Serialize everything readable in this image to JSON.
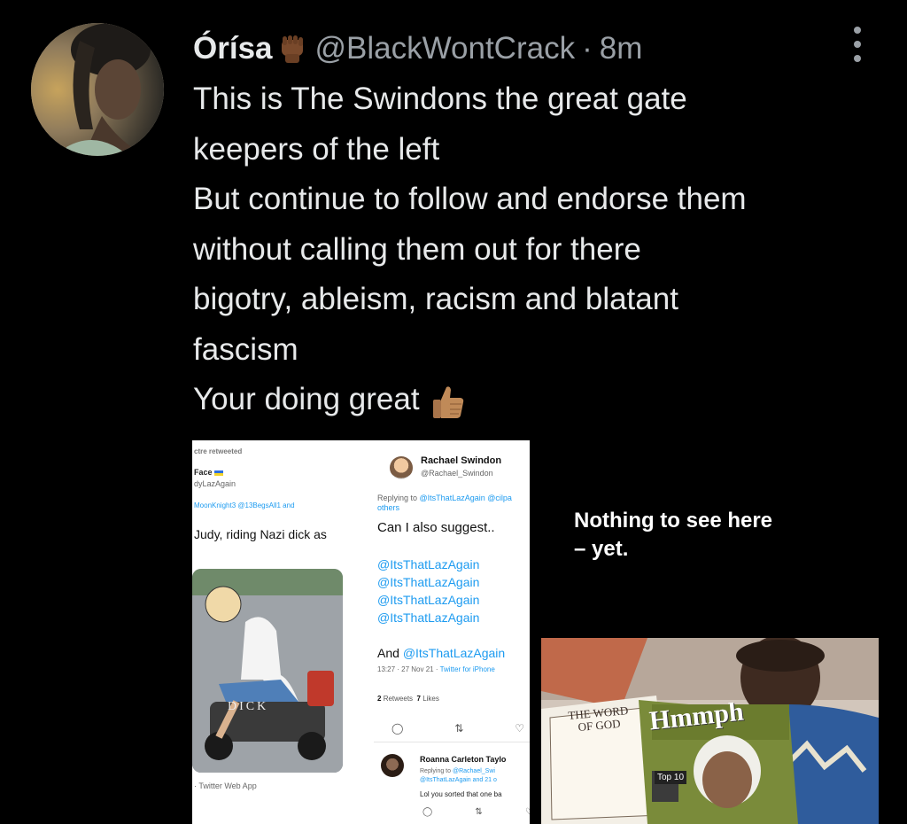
{
  "tweet": {
    "author_name": "Órísa",
    "author_emoji": "raised-fist-dark-skin",
    "handle": "@BlackWontCrack",
    "separator": "·",
    "time": "8m",
    "lines": [
      "This is The Swindons the great gate",
      "keepers of the left",
      "But continue to follow and endorse them",
      "without calling them out for there",
      "bigotry, ableism, racism and blatant",
      "fascism",
      "Your doing great"
    ],
    "end_emoji": "thumbs-up-medium-skin"
  },
  "image1": {
    "left": {
      "retweeted": "ctre retweeted",
      "face": "Face",
      "lazagain": "dyLazAgain",
      "reply": "MoonKnight3 @13BegsAll1 and",
      "judy": "Judy, riding Nazi dick as",
      "overlay": "DICK",
      "app": "· Twitter Web App"
    },
    "right": {
      "name": "Rachael Swindon",
      "handle": "@Rachael_Swindon",
      "replying_prefix": "Replying to",
      "replying_users": "@ItsThatLazAgain @cilpa",
      "replying_others": "others",
      "suggest": "Can I also suggest..",
      "mentions": [
        "@ItsThatLazAgain",
        "@ItsThatLazAgain",
        "@ItsThatLazAgain",
        "@ItsThatLazAgain"
      ],
      "and_word": "And",
      "and_mention": "@ItsThatLazAgain",
      "timestamp": "13:27 · 27 Nov 21 ·",
      "via": "Twitter for iPhone",
      "retweets_count": "2",
      "retweets_label": "Retweets",
      "likes_count": "7",
      "likes_label": "Likes",
      "reply2_name": "Roanna Carleton Taylo",
      "reply2_replying": "Replying to",
      "reply2_user": "@Rachael_Swi",
      "reply2_more": "@ItsThatLazAgain and 21 o",
      "reply2_text": "Lol you sorted that one ba"
    }
  },
  "image2": {
    "caption_line1": "Nothing to see here",
    "caption_line2": "– yet.",
    "magazine_left_title_1": "THE WORD",
    "magazine_left_title_2": "OF GOD",
    "magazine_title": "Hmmph",
    "badge": "Top 10"
  }
}
